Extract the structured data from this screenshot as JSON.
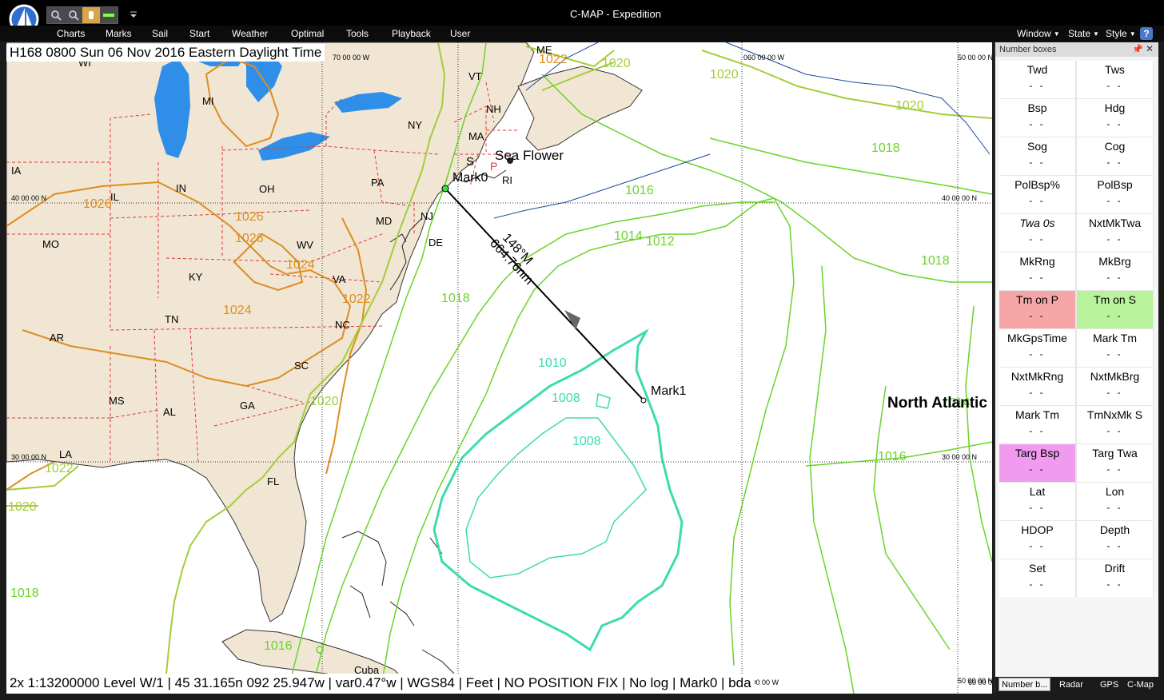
{
  "window": {
    "title": "C-MAP - Expedition"
  },
  "menubar": {
    "left": [
      "Charts",
      "Marks",
      "Sail",
      "Start",
      "Weather",
      "Optimal",
      "Tools",
      "Playback",
      "User"
    ],
    "right": [
      "Window",
      "State",
      "Style"
    ],
    "help": "?"
  },
  "map": {
    "header": "H168 0800 Sun 06 Nov 2016 Eastern Daylight Time",
    "status": "2x 1:13200000 Level W/1 | 45 31.165n 092 25.947w | var0.47°w | WGS84 | Feet | NO POSITION FIX | No log | Mark0 | bda",
    "lat_labels": [
      "40 00 00 N",
      "30 00 00 N",
      "40 00 00 N",
      "30 00 00 N",
      "50 00 00 N",
      "50 00 00 N"
    ],
    "lon_labels": [
      "70 00 00 W",
      "060 00 00 W",
      "70 00 00 W",
      "60 00 00 W"
    ],
    "states": [
      "WI",
      "MI",
      "IA",
      "IL",
      "IN",
      "OH",
      "MO",
      "KY",
      "AR",
      "TN",
      "MS",
      "AL",
      "GA",
      "SC",
      "NC",
      "VA",
      "WV",
      "MD",
      "DE",
      "PA",
      "NJ",
      "NY",
      "VT",
      "NH",
      "MA",
      "ME",
      "RI",
      "FL",
      "LA",
      "Cuba"
    ],
    "isobars": [
      "1020",
      "1020",
      "1020",
      "1018",
      "1016",
      "1014",
      "1012",
      "1018",
      "1010",
      "1008",
      "1008",
      "1018",
      "1016",
      "1014",
      "1020",
      "1020",
      "1022",
      "1018",
      "1016",
      "1026",
      "1026",
      "1026",
      "1024",
      "1024",
      "1022",
      "1022"
    ],
    "marks": {
      "mark0": "Mark0",
      "mark1": "Mark1",
      "boat": "Sea Flower",
      "route_bearing": "148°M",
      "route_distance": "664.76nm",
      "ocean": "North Atlantic",
      "s_label": "S",
      "p_label": "P"
    }
  },
  "panel": {
    "title": "Number boxes",
    "boxes": [
      {
        "label": "Twd",
        "value": "- -"
      },
      {
        "label": "Tws",
        "value": "- -"
      },
      {
        "label": "Bsp",
        "value": "- -"
      },
      {
        "label": "Hdg",
        "value": "- -"
      },
      {
        "label": "Sog",
        "value": "- -"
      },
      {
        "label": "Cog",
        "value": "- -"
      },
      {
        "label": "PolBsp%",
        "value": "- -"
      },
      {
        "label": "PolBsp",
        "value": "- -"
      },
      {
        "label": "Twa 0s",
        "value": "- -"
      },
      {
        "label": "NxtMkTwa",
        "value": "- -"
      },
      {
        "label": "MkRng",
        "value": "- -"
      },
      {
        "label": "MkBrg",
        "value": "- -"
      },
      {
        "label": "Tm on P",
        "value": "- -"
      },
      {
        "label": "Tm on S",
        "value": "- -"
      },
      {
        "label": "MkGpsTime",
        "value": "- -"
      },
      {
        "label": "Mark Tm",
        "value": "- -"
      },
      {
        "label": "NxtMkRng",
        "value": "- -"
      },
      {
        "label": "NxtMkBrg",
        "value": "- -"
      },
      {
        "label": "Mark Tm",
        "value": "- -"
      },
      {
        "label": "TmNxMk S",
        "value": "- -"
      },
      {
        "label": "Targ Bsp",
        "value": "- -"
      },
      {
        "label": "Targ Twa",
        "value": "- -"
      },
      {
        "label": "Lat",
        "value": "- -"
      },
      {
        "label": "Lon",
        "value": "- -"
      },
      {
        "label": "HDOP",
        "value": "- -"
      },
      {
        "label": "Depth",
        "value": "- -"
      },
      {
        "label": "Set",
        "value": "- -"
      },
      {
        "label": "Drift",
        "value": "- -"
      }
    ],
    "tabs": [
      "Number b...",
      "Radar",
      "GPS",
      "C-Map"
    ]
  },
  "colors": {
    "land": "#f0e6d3",
    "water": "#ffffff",
    "lake": "#2f8fe8",
    "tm_on_p": "#f6a6a6",
    "tm_on_s": "#b8f39b",
    "targ_bsp": "#f09af0",
    "isobar_green": "#6ad32a",
    "isobar_teal": "#3ddbb0",
    "isobar_orange": "#dc8e22"
  }
}
